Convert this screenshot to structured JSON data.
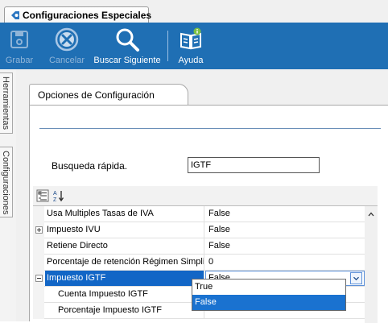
{
  "tab": {
    "title": "Configuraciones Especiales",
    "icon": "config-tab-icon"
  },
  "toolbar": {
    "buttons": [
      {
        "label": "Grabar",
        "icon": "save-icon",
        "enabled": false
      },
      {
        "label": "Cancelar",
        "icon": "cancel-icon",
        "enabled": false
      },
      {
        "label": "Buscar Siguiente",
        "icon": "search-icon",
        "enabled": true
      },
      {
        "label": "Ayuda",
        "icon": "help-book-icon",
        "enabled": true
      }
    ]
  },
  "side_tabs": [
    "Herramientas",
    "Configuraciones"
  ],
  "options": {
    "tab_label": "Opciones de Configuración",
    "quick_search": {
      "label": "Busqueda rápida.",
      "value": "IGTF"
    }
  },
  "property_grid": {
    "toolbar_icons": [
      "categorized-view-icon",
      "alphabetical-sort-icon"
    ],
    "rows": [
      {
        "name": "Usa Multiples Tasas de IVA",
        "value": "False",
        "expander": "none"
      },
      {
        "name": "Impuesto IVU",
        "value": "False",
        "expander": "plus"
      },
      {
        "name": "Retiene Directo",
        "value": "False",
        "expander": "none"
      },
      {
        "name": "Porcentaje de retención Régimen Simplificado",
        "value": "0",
        "expander": "none"
      },
      {
        "name": "Impuesto IGTF",
        "value": "False",
        "expander": "minus",
        "selected": true
      },
      {
        "name": "Cuenta Impuesto IGTF",
        "value": "",
        "expander": "none",
        "indent": true
      },
      {
        "name": "Porcentaje Impuesto IGTF",
        "value": "",
        "expander": "none",
        "indent": true
      }
    ],
    "dropdown_options": [
      "True",
      "False"
    ],
    "dropdown_selected": "False"
  },
  "colors": {
    "toolbar_bg": "#1f6fb4",
    "selection": "#1266c6"
  }
}
